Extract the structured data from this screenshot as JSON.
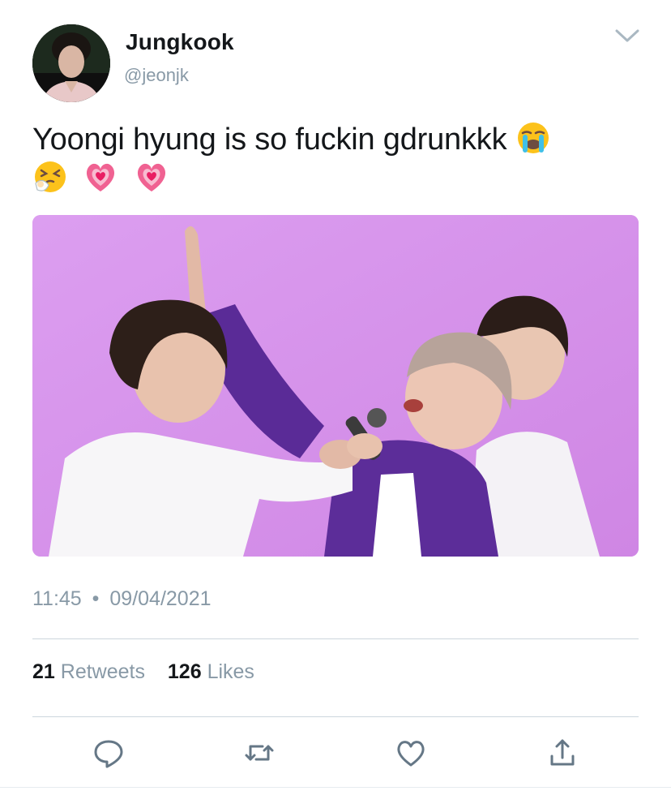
{
  "tweet": {
    "display_name": "Jungkook",
    "handle": "@jeonjk",
    "text": "Yoongi hyung is so fuckin gdrunkkk",
    "emojis": [
      "loudly-crying-face",
      "sneezing-face",
      "growing-heart",
      "growing-heart"
    ],
    "time": "11:45",
    "separator": "•",
    "date": "09/04/2021",
    "retweets_count": "21",
    "retweets_label": "Retweets",
    "likes_count": "126",
    "likes_label": "Likes"
  },
  "icons": {
    "menu": "chevron-down-icon",
    "reply": "reply-icon",
    "retweet": "retweet-icon",
    "like": "heart-icon",
    "share": "share-icon"
  },
  "colors": {
    "text": "#14171a",
    "secondary": "#8899a6",
    "divider": "#ccd6dd",
    "media_background": "#d890e8"
  }
}
